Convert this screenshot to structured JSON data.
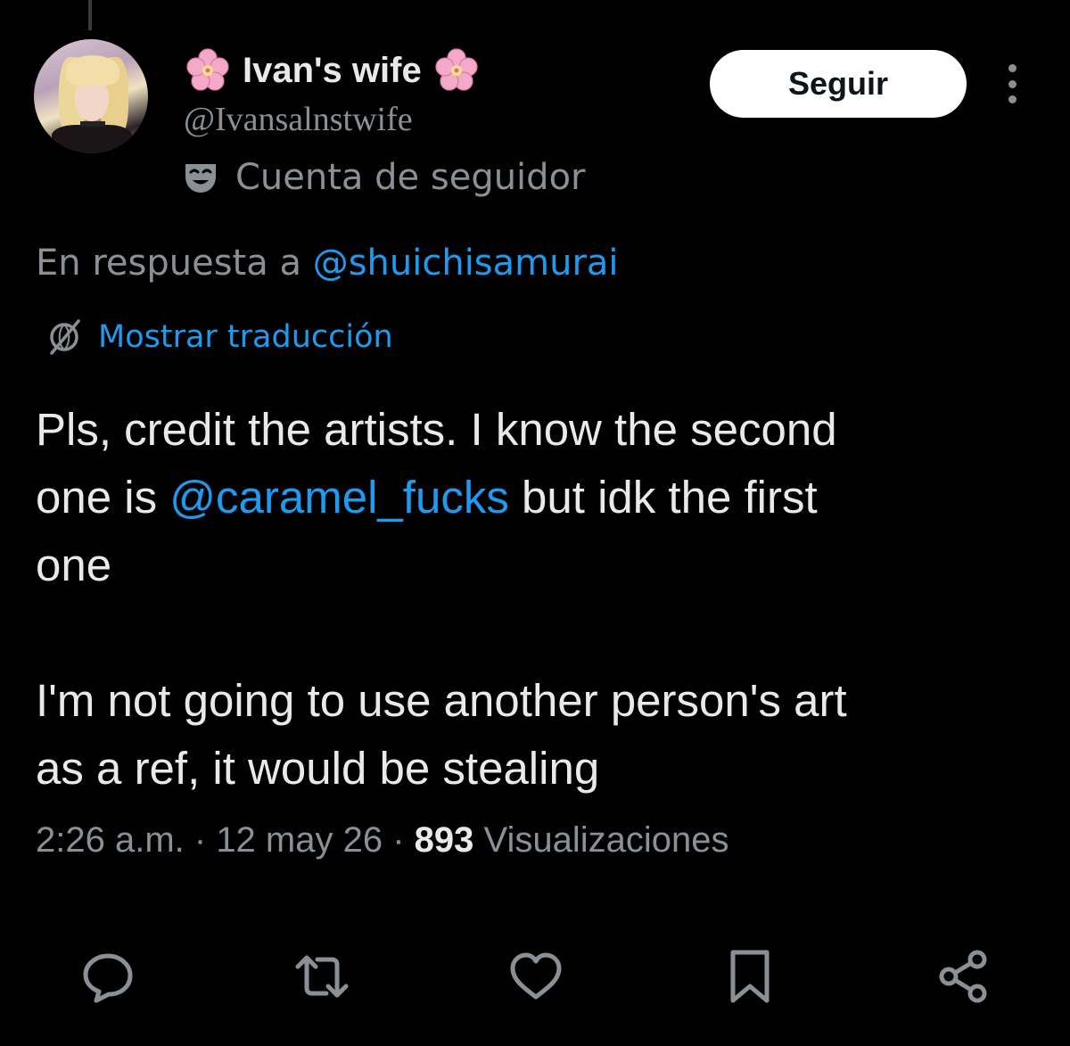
{
  "user": {
    "display_name": "Ivan's wife",
    "handle": "@Ivansalnstwife",
    "badge_label": "Cuenta de seguidor",
    "badge_icon": "mask-icon",
    "name_decoration_icon": "cherry-blossom-icon"
  },
  "header": {
    "follow_label": "Seguir",
    "more_icon": "more-vertical-icon"
  },
  "reply": {
    "prefix": "En respuesta a ",
    "mention": "@shuichisamurai"
  },
  "translate": {
    "label": "Mostrar traducción",
    "icon": "globe-icon"
  },
  "tweet": {
    "line1": "Pls, credit the artists. I know the second",
    "line2_pre": "one is ",
    "line2_mention": "@caramel_fucks",
    "line2_post": " but idk the first",
    "line3": "one",
    "line4": "I'm not going to use another person's art",
    "line5": "as a ref, it would be stealing"
  },
  "meta": {
    "time": "2:26 a.m.",
    "sep1": " · ",
    "date": "12 may 26",
    "sep2": " · ",
    "views_count": "893",
    "views_label": " Visualizaciones"
  },
  "actions": [
    {
      "name": "reply-icon"
    },
    {
      "name": "retweet-icon"
    },
    {
      "name": "like-icon"
    },
    {
      "name": "bookmark-icon"
    },
    {
      "name": "share-icon"
    }
  ],
  "colors": {
    "background": "#000000",
    "text": "#e7e9ea",
    "muted": "#8b9096",
    "link": "#1d9bf0",
    "flower": "#f4a9c8"
  }
}
